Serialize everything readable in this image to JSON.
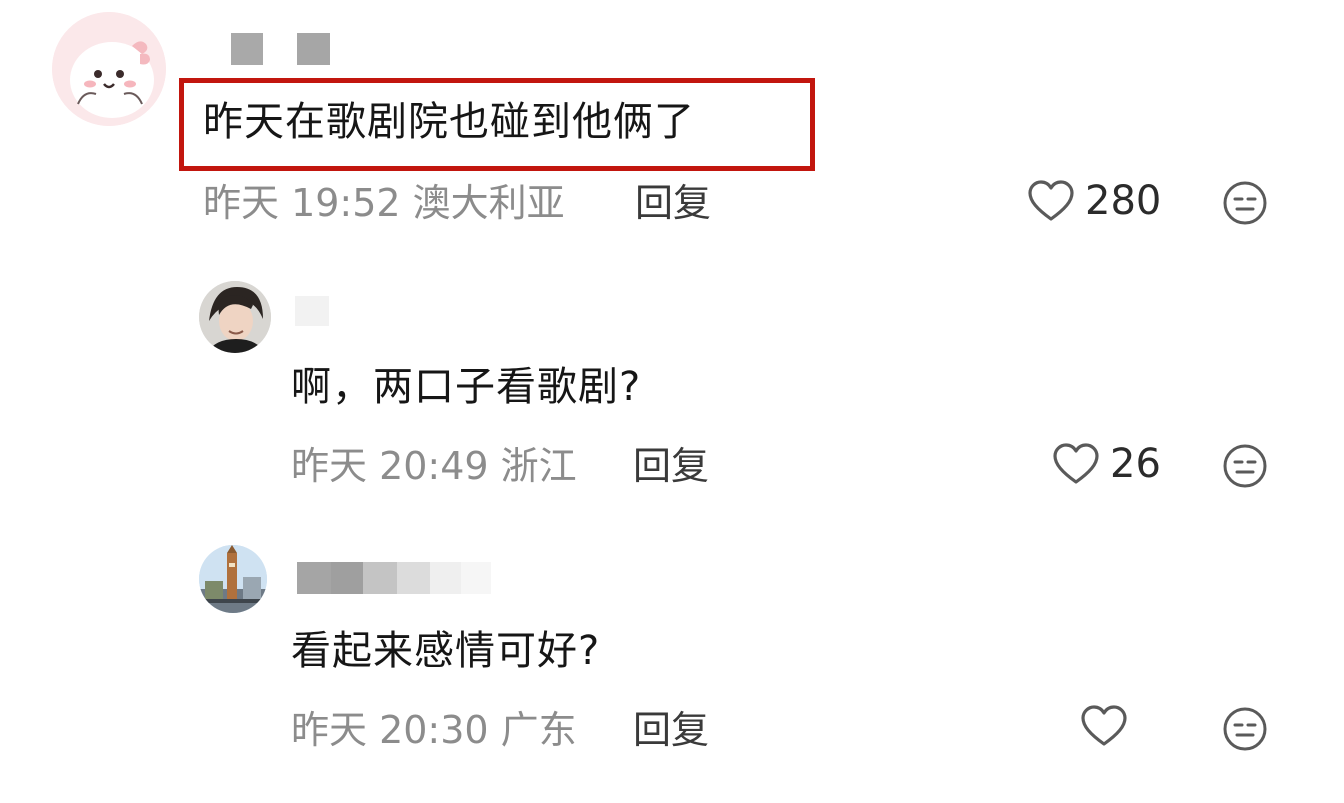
{
  "comments": [
    {
      "text": "昨天在歌剧院也碰到他俩了",
      "meta": "昨天 19:52 澳大利亚",
      "reply_label": "回复",
      "likes": "280",
      "highlighted": true
    },
    {
      "text": "啊，两口子看歌剧?",
      "meta": "昨天 20:49 浙江",
      "reply_label": "回复",
      "likes": "26"
    },
    {
      "text": "看起来感情可好?",
      "meta": "昨天 20:30 广东",
      "reply_label": "回复",
      "likes": ""
    }
  ],
  "colors": {
    "highlight": "#c2160e",
    "meta_text": "#8c8c8c",
    "icon_stroke": "#5a5a5a"
  },
  "icons": {
    "like": "heart-outline-icon",
    "emoji": "neutral-face-icon"
  }
}
